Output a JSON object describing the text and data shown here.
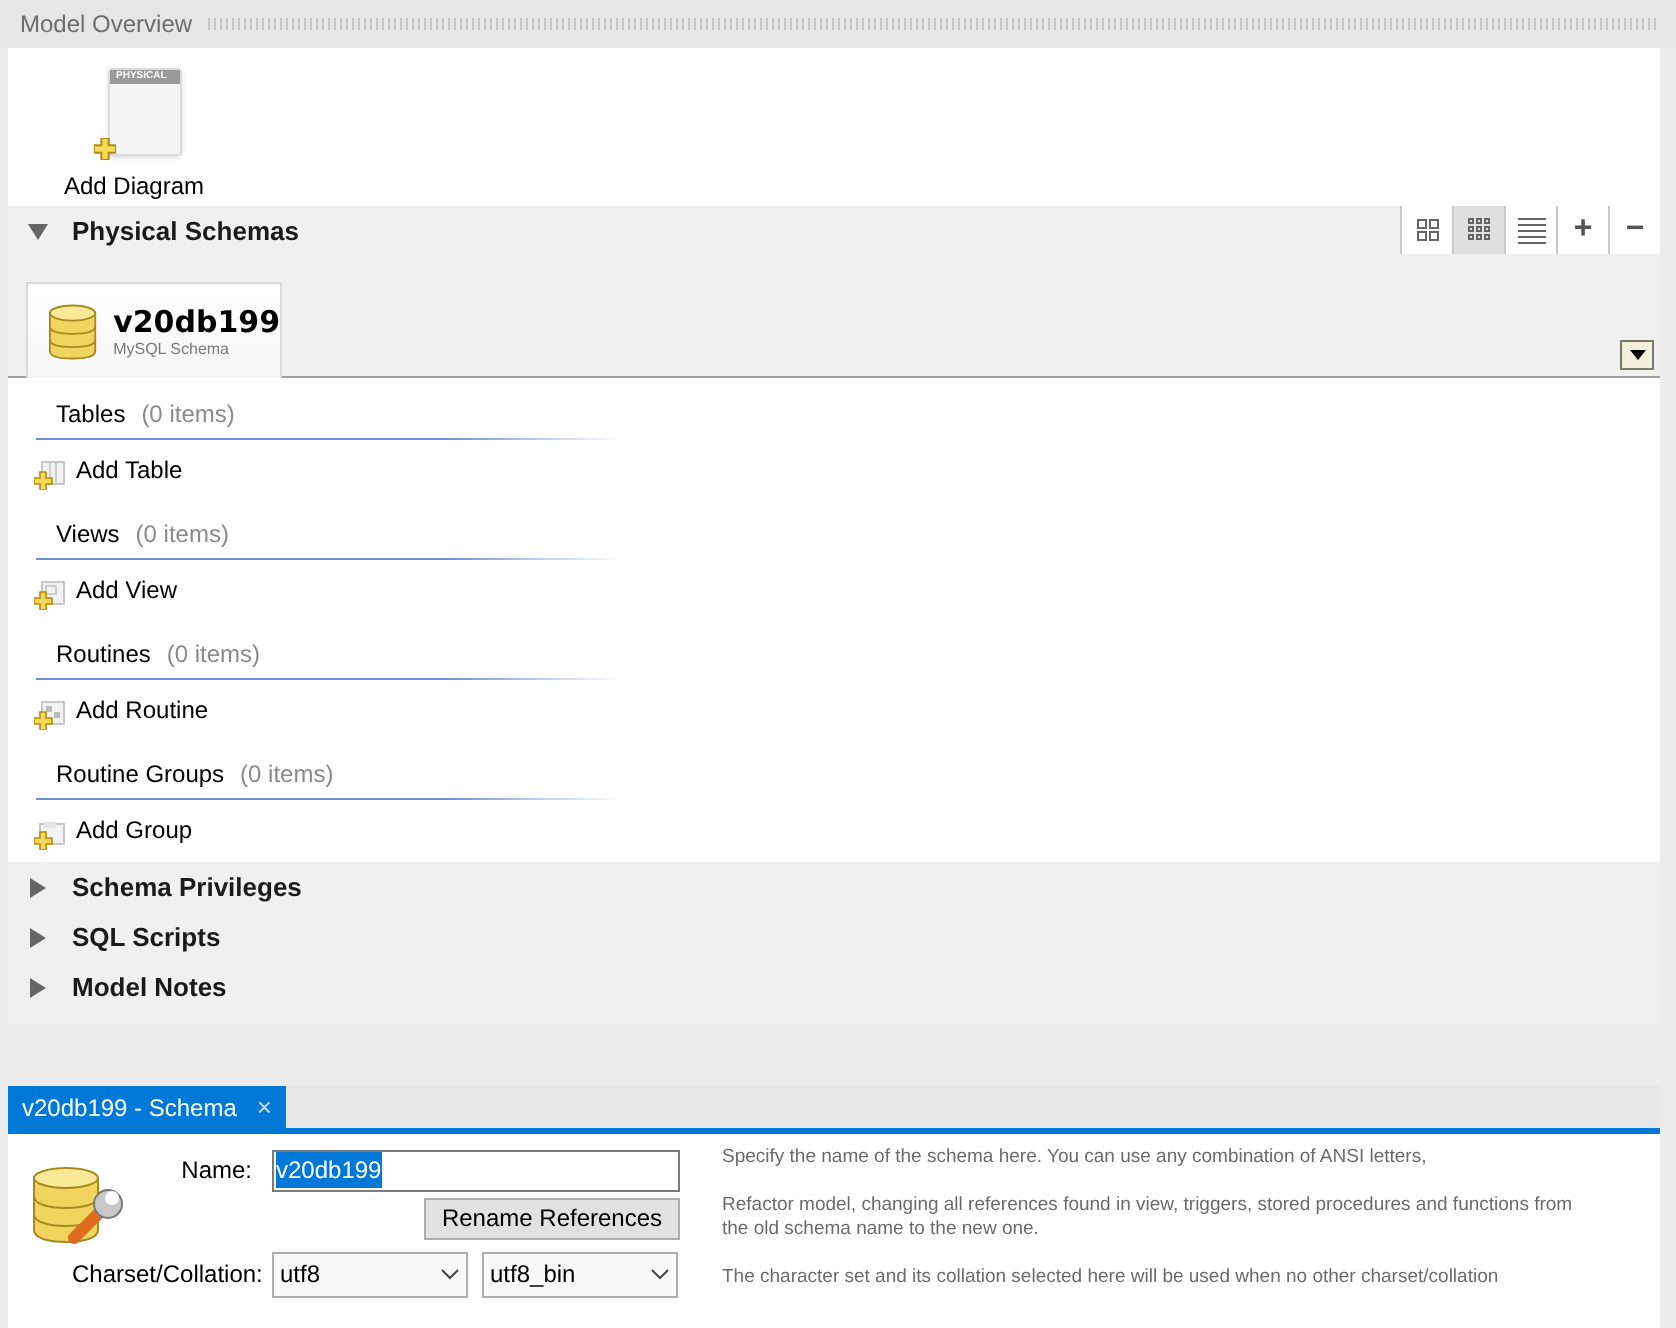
{
  "header": {
    "title": "Model Overview"
  },
  "diagram_action": {
    "label": "Add Diagram",
    "icon_caption": "PHYSICAL"
  },
  "sections": [
    {
      "title": "Physical Schemas",
      "expanded": true,
      "view_modes": [
        {
          "kind": "large",
          "selected": false
        },
        {
          "kind": "small",
          "selected": true
        },
        {
          "kind": "list",
          "selected": false
        }
      ],
      "toolbar_buttons": [
        "+",
        "−"
      ],
      "schemas": [
        {
          "name": "v20db199",
          "subtitle": "MySQL Schema",
          "selected": true
        }
      ],
      "groups": [
        {
          "kind": "table",
          "title": "Tables",
          "count": "(0 items)",
          "action": "Add Table"
        },
        {
          "kind": "view",
          "title": "Views",
          "count": "(0 items)",
          "action": "Add View"
        },
        {
          "kind": "routine",
          "title": "Routines",
          "count": "(0 items)",
          "action": "Add Routine"
        },
        {
          "kind": "group",
          "title": "Routine Groups",
          "count": "(0 items)",
          "action": "Add Group"
        }
      ]
    },
    {
      "title": "Schema Privileges",
      "expanded": false
    },
    {
      "title": "SQL Scripts",
      "expanded": false
    },
    {
      "title": "Model Notes",
      "expanded": false
    }
  ],
  "editor": {
    "tab": {
      "title": "v20db199 - Schema",
      "close": "×",
      "selected": true
    },
    "name_label": "Name:",
    "name_value": "v20db199",
    "name_text_selected": true,
    "rename_button": "Rename References",
    "charset_label": "Charset/Collation:",
    "charset": "utf8",
    "collation": "utf8_bin",
    "help": [
      "Specify the name of the schema here. You can use any combination of ANSI letters,",
      "Refactor model, changing all references found in view, triggers, stored procedures and functions from the old schema name to the new one.",
      "The character set and its collation selected here will be used when no other charset/collation"
    ]
  }
}
